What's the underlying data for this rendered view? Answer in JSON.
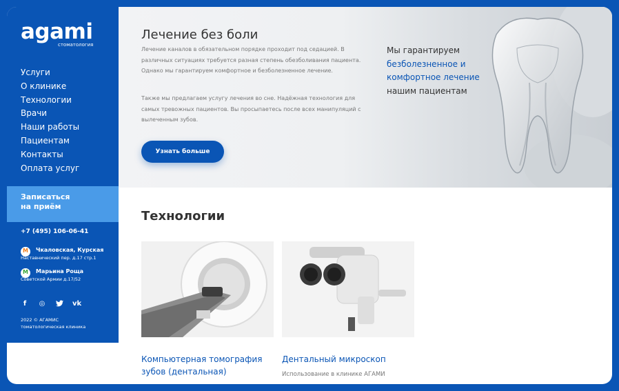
{
  "brand": {
    "name": "agami",
    "tagline": "стоматология"
  },
  "nav": [
    "Услуги",
    "О клинике",
    "Технологии",
    "Врачи",
    "Наши работы",
    "Пациентам",
    "Контакты",
    "Оплата услуг"
  ],
  "cta": {
    "line1": "Записаться",
    "line2": "на приём"
  },
  "phone": "+7 (495) 106-06-41",
  "addresses": [
    {
      "station": "Чкаловская, Курская",
      "address": "Наставнический пер. д.17 стр.1",
      "icon": "metro-orange-icon",
      "color": "#f07f1f"
    },
    {
      "station": "Марьина Роща",
      "address": "Советской Армии д.17/52",
      "icon": "metro-green-icon",
      "color": "#3aa63a"
    }
  ],
  "social": [
    {
      "name": "facebook-icon",
      "glyph": "f"
    },
    {
      "name": "instagram-icon",
      "glyph": "◎"
    },
    {
      "name": "twitter-icon",
      "glyph": "🐦"
    },
    {
      "name": "vk-icon",
      "glyph": "vk"
    }
  ],
  "copyright": {
    "line1": "2022 © АГАМИС",
    "line2": "томатологическая клиника"
  },
  "hero": {
    "title": "Лечение без боли",
    "p1": "Лечение каналов в обязательном порядке проходит под седацией. В различных ситуациях требуется разная степень обезболивания пациента. Однако мы гарантируем комфортное и безболезненное лечение.",
    "p2": "Также мы предлагаем услугу лечения во сне. Надёжная технология для самых тревожных пациентов. Вы просыпаетесь после всех манипуляций с вылеченным зубов.",
    "button": "Узнать больше",
    "guarantee_a": "Мы гарантируем",
    "guarantee_hl": "безболезненное и комфортное лечение",
    "guarantee_b": "нашим пациентам"
  },
  "technologies": {
    "title": "Технологии",
    "cards": [
      {
        "title": "Компьютерная томография зубов (дентальная)",
        "subtitle": ""
      },
      {
        "title": "Дентальный микроскоп",
        "subtitle": "Использование в клинике АГАМИ"
      }
    ]
  },
  "colors": {
    "brand": "#0a55b5",
    "cta": "#4a9be8"
  }
}
